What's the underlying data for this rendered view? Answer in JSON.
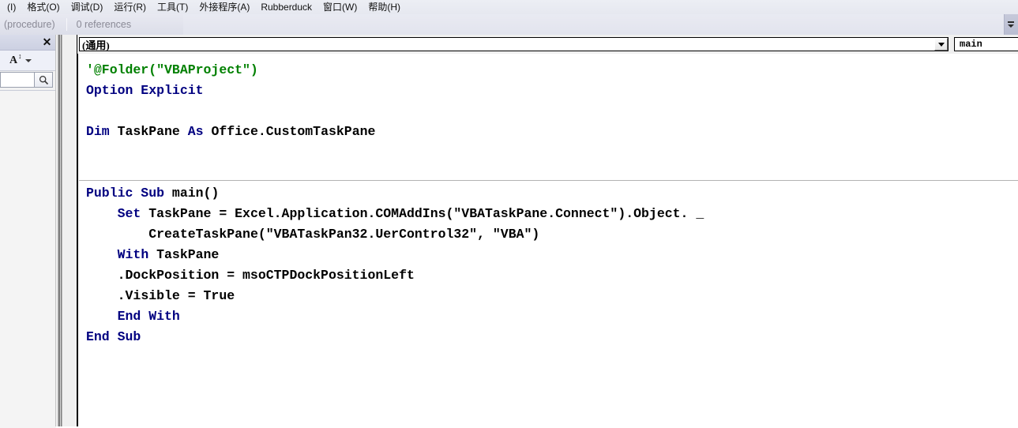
{
  "menubar": {
    "items": [
      {
        "label": "(I)"
      },
      {
        "label": "格式(O)"
      },
      {
        "label": "调试(D)"
      },
      {
        "label": "运行(R)"
      },
      {
        "label": "工具(T)"
      },
      {
        "label": "外接程序(A)"
      },
      {
        "label": "Rubberduck"
      },
      {
        "label": "窗口(W)"
      },
      {
        "label": "帮助(H)"
      }
    ]
  },
  "codelens": {
    "procedure_label": "(procedure)",
    "references_label": "0 references"
  },
  "left_panel": {
    "close_label": "✕",
    "sort_icon_label": "A",
    "sort_icon_arrows": "↕",
    "search_value": "",
    "search_placeholder": "",
    "search_icon": "search-icon"
  },
  "code_pane": {
    "scope_dropdown": "(通用)",
    "procedure_dropdown": "main",
    "code_lines": [
      {
        "indent": 0,
        "segments": [
          {
            "text": "'@Folder(\"VBAProject\")",
            "cls": "cmt"
          }
        ]
      },
      {
        "indent": 0,
        "segments": [
          {
            "text": "Option Explicit",
            "cls": "kw"
          }
        ]
      },
      {
        "indent": 0,
        "segments": [
          {
            "text": "",
            "cls": "id"
          }
        ]
      },
      {
        "indent": 0,
        "segments": [
          {
            "text": "Dim",
            "cls": "kw"
          },
          {
            "text": " TaskPane ",
            "cls": "id"
          },
          {
            "text": "As",
            "cls": "kw"
          },
          {
            "text": " Office.CustomTaskPane",
            "cls": "id"
          }
        ]
      },
      {
        "indent": 0,
        "segments": [
          {
            "text": "",
            "cls": "id"
          }
        ]
      },
      {
        "indent": 0,
        "segments": [
          {
            "text": "",
            "cls": "id"
          }
        ]
      },
      {
        "indent": 0,
        "segments": [
          {
            "text": "Public Sub",
            "cls": "kw"
          },
          {
            "text": " main()",
            "cls": "id"
          }
        ]
      },
      {
        "indent": 4,
        "segments": [
          {
            "text": "Set",
            "cls": "kw"
          },
          {
            "text": " TaskPane = Excel.Application.COMAddIns(\"VBATaskPane.Connect\").Object. _",
            "cls": "id"
          }
        ]
      },
      {
        "indent": 8,
        "segments": [
          {
            "text": "CreateTaskPane(\"VBATaskPan32.UerControl32\", \"VBA\")",
            "cls": "id"
          }
        ]
      },
      {
        "indent": 4,
        "segments": [
          {
            "text": "With",
            "cls": "kw"
          },
          {
            "text": " TaskPane",
            "cls": "id"
          }
        ]
      },
      {
        "indent": 4,
        "segments": [
          {
            "text": ".DockPosition = msoCTPDockPositionLeft",
            "cls": "id"
          }
        ]
      },
      {
        "indent": 4,
        "segments": [
          {
            "text": ".Visible = True",
            "cls": "id"
          }
        ]
      },
      {
        "indent": 4,
        "segments": [
          {
            "text": "End With",
            "cls": "kw"
          }
        ]
      },
      {
        "indent": 0,
        "segments": [
          {
            "text": "End Sub",
            "cls": "kw"
          }
        ]
      }
    ]
  },
  "colors": {
    "keyword": "#000080",
    "comment": "#008000",
    "identifier": "#000000",
    "menubar_bg": "#e9ebf3",
    "panel_bg": "#f2f2f2",
    "editor_bg": "#ffffff"
  }
}
